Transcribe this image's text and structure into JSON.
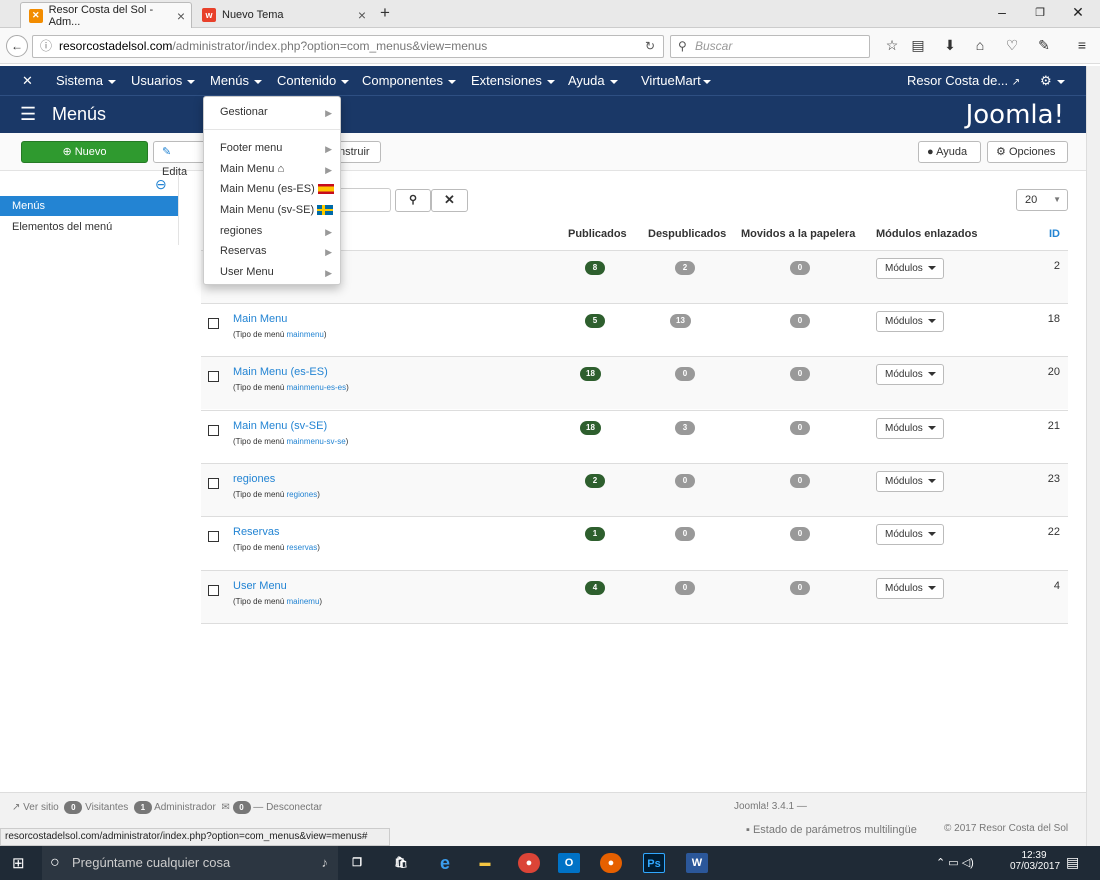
{
  "browser": {
    "tabs": [
      {
        "title": "Resor Costa del Sol - Adm..."
      },
      {
        "title": "Nuevo Tema"
      }
    ],
    "new_tab": "+",
    "url_host": "resorcostadelsol.com",
    "url_path": "/administrator/index.php?option=com_menus&view=menus",
    "search_placeholder": "Buscar",
    "status_url": "resorcostadelsol.com/administrator/index.php?option=com_menus&view=menus#"
  },
  "topmenu": {
    "items": [
      "Sistema",
      "Usuarios",
      "Menús",
      "Contenido",
      "Componentes",
      "Extensiones",
      "Ayuda",
      "VirtueMart"
    ],
    "site_link": "Resor Costa de..."
  },
  "header": {
    "title": "Menús",
    "logo": "Joomla!"
  },
  "toolbar": {
    "new": "Nuevo",
    "edit": "Edita",
    "rebuild": "nstruir",
    "help": "Ayuda",
    "options": "Opciones"
  },
  "sidebar": {
    "items": [
      "Menús",
      "Elementos del menú"
    ]
  },
  "dropdown": {
    "items": [
      "Gestionar",
      "Footer menu",
      "Main Menu",
      "Main Menu (es-ES)",
      "Main Menu (sv-SE)",
      "regiones",
      "Reservas",
      "User Menu"
    ]
  },
  "filter": {
    "limit": "20"
  },
  "table": {
    "headers": [
      "Publicados",
      "Despublicados",
      "Movidos a la papelera",
      "Módulos enlazados",
      "ID"
    ],
    "type_prefix": "(Tipo de menú ",
    "type_suffix": ")",
    "modules_label": "Módulos",
    "rows": [
      {
        "title": "",
        "type": "",
        "published": "8",
        "unpublished": "2",
        "trashed": "0",
        "id": "2"
      },
      {
        "title": "Main Menu",
        "type": "mainmenu",
        "published": "5",
        "unpublished": "13",
        "trashed": "0",
        "id": "18"
      },
      {
        "title": "Main Menu (es-ES)",
        "type": "mainmenu-es-es",
        "published": "18",
        "unpublished": "0",
        "trashed": "0",
        "id": "20"
      },
      {
        "title": "Main Menu (sv-SE)",
        "type": "mainmenu-sv-se",
        "published": "18",
        "unpublished": "3",
        "trashed": "0",
        "id": "21"
      },
      {
        "title": "regiones",
        "type": "regiones",
        "published": "2",
        "unpublished": "0",
        "trashed": "0",
        "id": "23"
      },
      {
        "title": "Reservas",
        "type": "reservas",
        "published": "1",
        "unpublished": "0",
        "trashed": "0",
        "id": "22"
      },
      {
        "title": "User Menu",
        "type": "mainemu",
        "published": "4",
        "unpublished": "0",
        "trashed": "0",
        "id": "4"
      }
    ]
  },
  "footer": {
    "view_site": "Ver sitio",
    "visitors_count": "0",
    "visitors": "Visitantes",
    "admins_count": "1",
    "admins": "Administrador",
    "messages_count": "0",
    "logout": "Desconectar",
    "version": "Joomla! 3.4.1 —",
    "multilang": "Estado de parámetros multilingüe",
    "copyright": "© 2017 Resor Costa del Sol"
  },
  "taskbar": {
    "search_placeholder": "Pregúntame cualquier cosa",
    "time": "12:39",
    "date": "07/03/2017"
  }
}
